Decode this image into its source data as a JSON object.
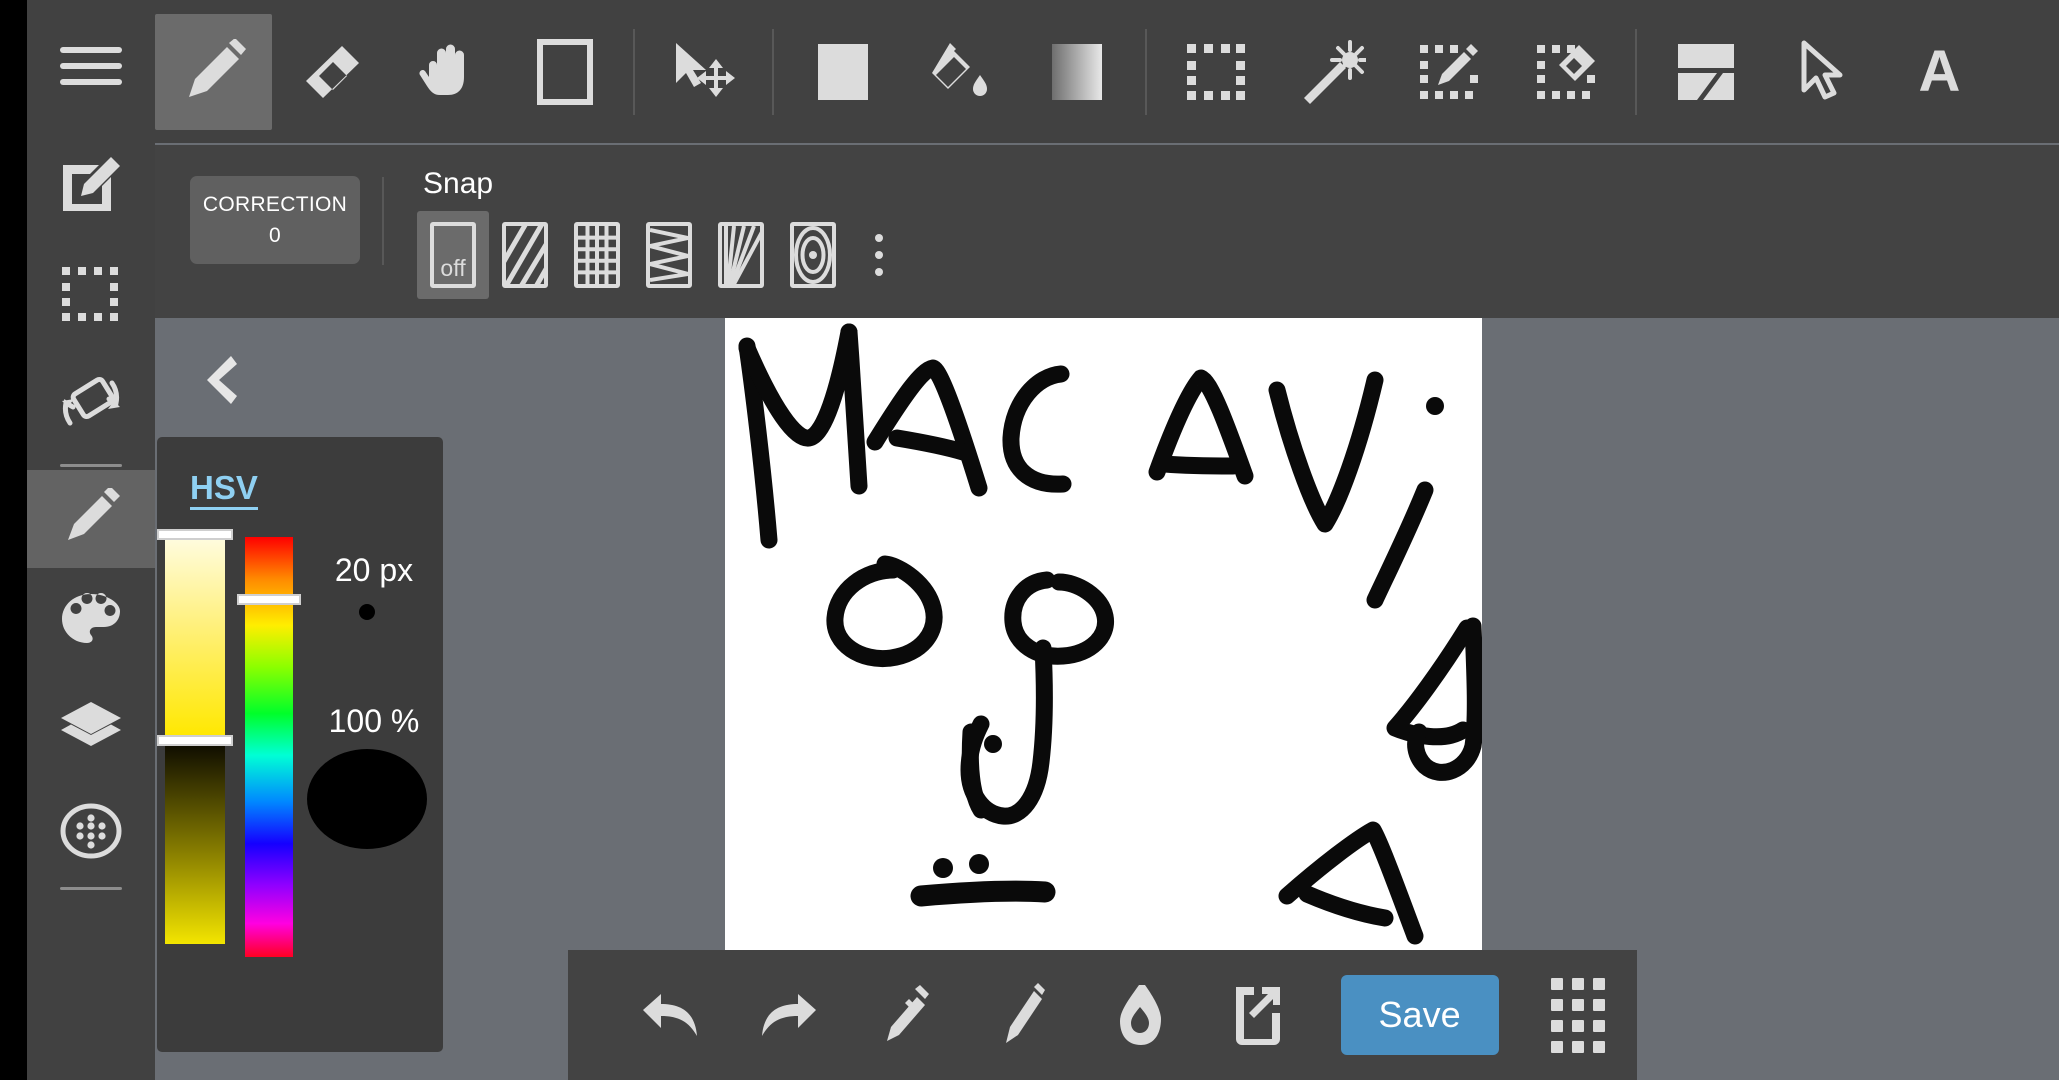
{
  "app": {
    "name": "mobile-drawing-app",
    "accent_color": "#4a90c2",
    "panel_color": "#414141",
    "workspace_color": "#6a6e74",
    "canvas_color": "#ffffff",
    "icon_color": "#dcdcdc"
  },
  "sidebar": {
    "items": [
      {
        "name": "menu-icon",
        "label": "Menu"
      },
      {
        "name": "new-canvas-icon",
        "label": "New Canvas"
      },
      {
        "name": "selection-icon",
        "label": "Selection"
      },
      {
        "name": "rotate-canvas-icon",
        "label": "Rotate Canvas"
      },
      {
        "name": "brush-icon",
        "label": "Brush",
        "active": true
      },
      {
        "name": "palette-icon",
        "label": "Palette"
      },
      {
        "name": "layers-icon",
        "label": "Layers"
      },
      {
        "name": "materials-icon",
        "label": "Materials"
      }
    ]
  },
  "toolbar": {
    "tools": [
      {
        "name": "pen-tool",
        "label": "Pen",
        "active": true
      },
      {
        "name": "eraser-tool",
        "label": "Eraser"
      },
      {
        "name": "hand-tool",
        "label": "Hand"
      },
      {
        "name": "shape-tool",
        "label": "Shape"
      },
      {
        "name": "move-tool",
        "label": "Move"
      },
      {
        "name": "fill-rect-tool",
        "label": "Fill Rectangle"
      },
      {
        "name": "bucket-tool",
        "label": "Bucket"
      },
      {
        "name": "gradient-tool",
        "label": "Gradient"
      },
      {
        "name": "marquee-select-tool",
        "label": "Marquee Select"
      },
      {
        "name": "magic-wand-tool",
        "label": "Magic Wand"
      },
      {
        "name": "select-pen-tool",
        "label": "Select Pen"
      },
      {
        "name": "select-eraser-tool",
        "label": "Select Eraser"
      },
      {
        "name": "transform-tool",
        "label": "Transform"
      },
      {
        "name": "cursor-tool",
        "label": "Cursor"
      },
      {
        "name": "text-tool",
        "label": "A"
      }
    ]
  },
  "options": {
    "correction": {
      "title": "CORRECTION",
      "value": "0"
    },
    "snap": {
      "label": "Snap",
      "buttons": [
        {
          "name": "snap-off",
          "label": "off",
          "active": true
        },
        {
          "name": "snap-parallel",
          "label": "Parallel Lines"
        },
        {
          "name": "snap-grid",
          "label": "Grid"
        },
        {
          "name": "snap-perspective",
          "label": "Perspective"
        },
        {
          "name": "snap-radial",
          "label": "Radial Lines"
        },
        {
          "name": "snap-concentric",
          "label": "Concentric Circles"
        }
      ],
      "more_label": "More options"
    }
  },
  "workspace": {
    "back_button_label": "Back"
  },
  "color_panel": {
    "title": "HSV",
    "brush_size": "20 px",
    "opacity": "100 %",
    "current_color": "#000000",
    "saturation_value_top_gradient": [
      "#fffce0",
      "#ffe800"
    ],
    "saturation_value_bottom_gradient": [
      "#0e0c00",
      "#f3e500"
    ],
    "hue_bar_label": "Hue"
  },
  "canvas": {
    "artwork_text": "MACAVIDA",
    "description": "Hand-drawn black marker sketch reading MACAVIDA with a cartoon face below",
    "background": "#ffffff",
    "stroke_color": "#000000"
  },
  "bottom_toolbar": {
    "buttons": [
      {
        "name": "undo-button",
        "label": "Undo"
      },
      {
        "name": "redo-button",
        "label": "Redo"
      },
      {
        "name": "eyedropper-button",
        "label": "Eyedropper"
      },
      {
        "name": "pencil-button",
        "label": "Pencil"
      },
      {
        "name": "eraser-button",
        "label": "Eraser"
      },
      {
        "name": "export-button",
        "label": "Export"
      }
    ],
    "save_label": "Save",
    "grid_label": "All Tools"
  }
}
